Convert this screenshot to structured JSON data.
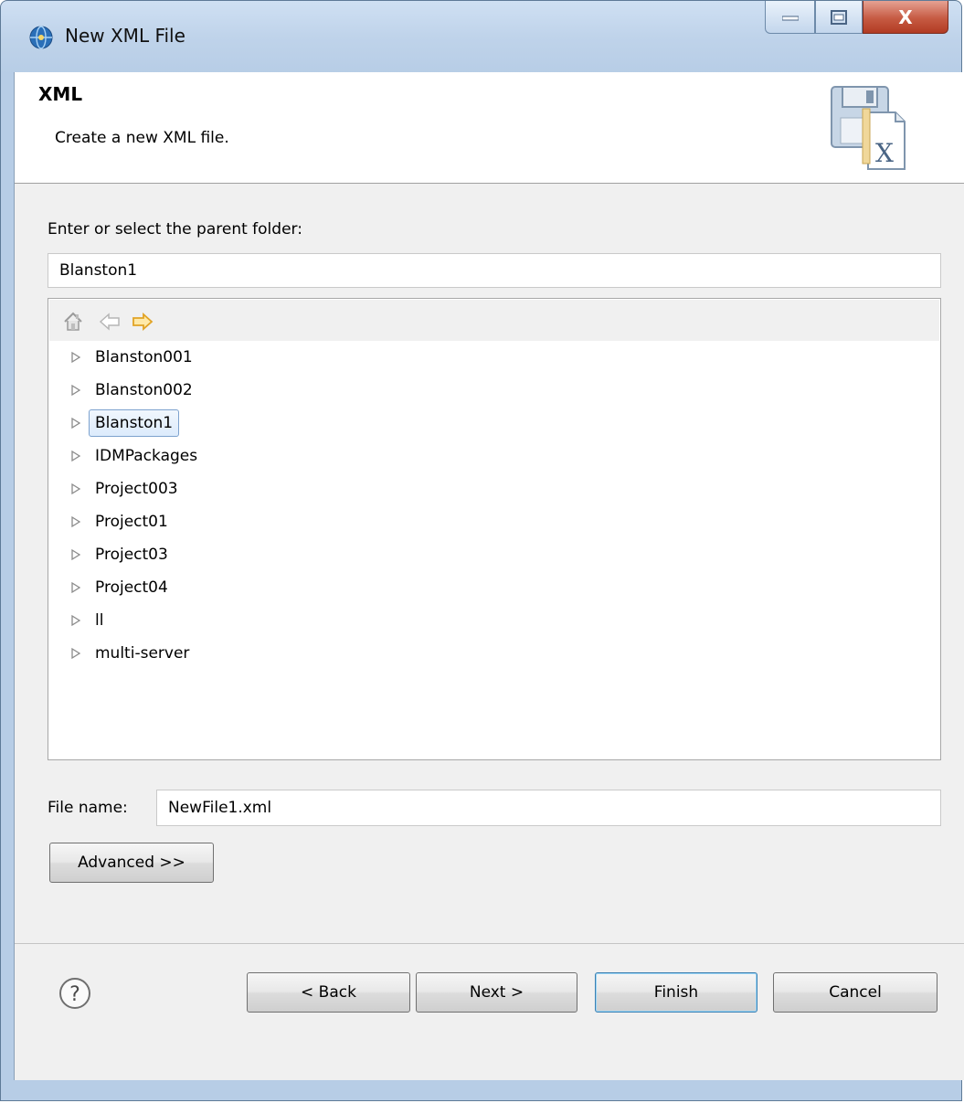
{
  "window": {
    "title": "New XML File",
    "controls": {
      "minimize": "minimize",
      "maximize": "maximize",
      "close": "X"
    }
  },
  "header": {
    "title": "XML",
    "description": "Create a new XML file.",
    "icon": "xml-file-wizard-icon"
  },
  "parent_folder": {
    "label": "Enter or select the parent folder:",
    "value": "Blanston1"
  },
  "tree": {
    "toolbar": [
      "home-icon",
      "back-arrow-icon",
      "forward-arrow-icon"
    ],
    "items": [
      {
        "label": "Blanston001",
        "selected": false
      },
      {
        "label": "Blanston002",
        "selected": false
      },
      {
        "label": "Blanston1",
        "selected": true
      },
      {
        "label": "IDMPackages",
        "selected": false
      },
      {
        "label": "Project003",
        "selected": false
      },
      {
        "label": "Project01",
        "selected": false
      },
      {
        "label": "Project03",
        "selected": false
      },
      {
        "label": "Project04",
        "selected": false
      },
      {
        "label": "ll",
        "selected": false
      },
      {
        "label": "multi-server",
        "selected": false
      }
    ]
  },
  "file_name": {
    "label": "File name:",
    "value": "NewFile1.xml"
  },
  "advanced_label": "Advanced >>",
  "footer": {
    "back": "< Back",
    "next": "Next >",
    "finish": "Finish",
    "cancel": "Cancel"
  },
  "colors": {
    "selection_border": "#7da2ce",
    "close_button": "#c65a43",
    "forward_arrow": "#f2b53a"
  }
}
